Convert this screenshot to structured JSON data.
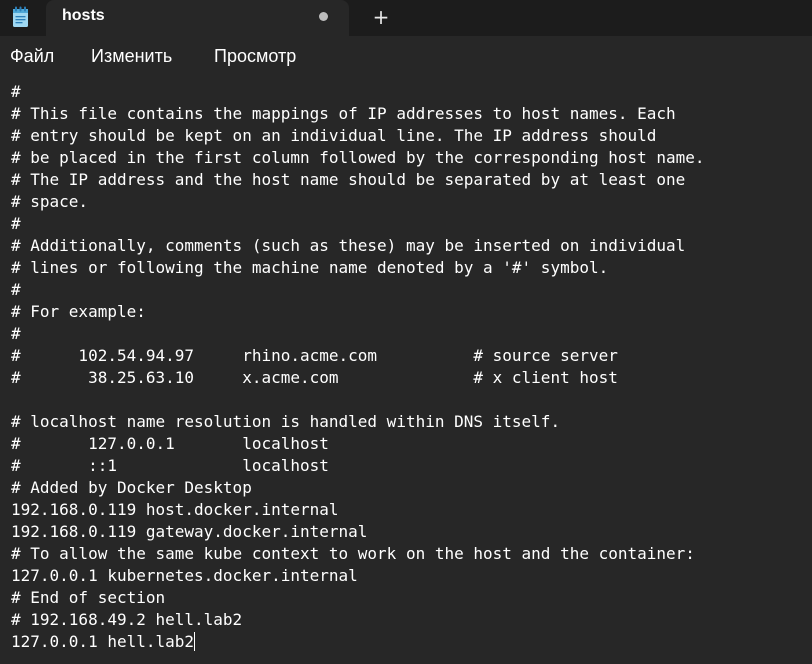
{
  "tab": {
    "title": "hosts",
    "icon": "notepad-icon",
    "modified_indicator": "unsaved-dot",
    "new_tab_label": "+"
  },
  "menu": {
    "file": "Файл",
    "edit": "Изменить",
    "view": "Просмотр"
  },
  "editor": {
    "lines": [
      "#",
      "# This file contains the mappings of IP addresses to host names. Each",
      "# entry should be kept on an individual line. The IP address should",
      "# be placed in the first column followed by the corresponding host name.",
      "# The IP address and the host name should be separated by at least one",
      "# space.",
      "#",
      "# Additionally, comments (such as these) may be inserted on individual",
      "# lines or following the machine name denoted by a '#' symbol.",
      "#",
      "# For example:",
      "#",
      "#      102.54.94.97     rhino.acme.com          # source server",
      "#       38.25.63.10     x.acme.com              # x client host",
      "",
      "# localhost name resolution is handled within DNS itself.",
      "#       127.0.0.1       localhost",
      "#       ::1             localhost",
      "# Added by Docker Desktop",
      "192.168.0.119 host.docker.internal",
      "192.168.0.119 gateway.docker.internal",
      "# To allow the same kube context to work on the host and the container:",
      "127.0.0.1 kubernetes.docker.internal",
      "# End of section",
      "# 192.168.49.2 hell.lab2",
      "127.0.0.1 hell.lab2"
    ]
  },
  "colors": {
    "background": "#272727",
    "titlebar": "#1c1c1c",
    "text": "#ffffff"
  }
}
